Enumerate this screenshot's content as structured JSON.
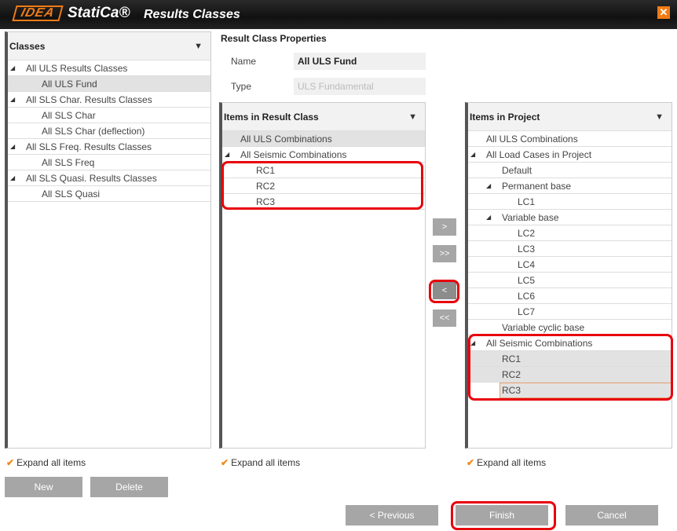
{
  "window": {
    "logo": "IDEA",
    "brand": "StatiCa®",
    "title": "Results Classes",
    "close": "✕"
  },
  "classes": {
    "header": "Classes",
    "rows": [
      {
        "label": "All ULS Results Classes",
        "level": 0,
        "expand": true
      },
      {
        "label": "All ULS Fund",
        "level": 1,
        "selected": true
      },
      {
        "label": "All SLS Char. Results Classes",
        "level": 0,
        "expand": true
      },
      {
        "label": "All SLS Char",
        "level": 1
      },
      {
        "label": "All SLS Char (deflection)",
        "level": 1
      },
      {
        "label": "All SLS Freq. Results Classes",
        "level": 0,
        "expand": true
      },
      {
        "label": "All SLS Freq",
        "level": 1
      },
      {
        "label": "All SLS Quasi. Results Classes",
        "level": 0,
        "expand": true
      },
      {
        "label": "All SLS Quasi",
        "level": 1
      }
    ]
  },
  "properties": {
    "title": "Result Class Properties",
    "name_label": "Name",
    "name_value": "All ULS Fund",
    "type_label": "Type",
    "type_value": "ULS Fundamental"
  },
  "result_items": {
    "header": "Items in Result Class",
    "rows": [
      {
        "label": "All ULS Combinations",
        "level": 0,
        "selected": true
      },
      {
        "label": "All Seismic Combinations",
        "level": 0,
        "expand": true
      },
      {
        "label": "RC1",
        "level": 1
      },
      {
        "label": "RC2",
        "level": 1
      },
      {
        "label": "RC3",
        "level": 1
      }
    ]
  },
  "project_items": {
    "header": "Items in Project",
    "rows": [
      {
        "label": "All ULS Combinations",
        "level": 0
      },
      {
        "label": "All Load Cases in Project",
        "level": 0,
        "expand": true
      },
      {
        "label": "Default",
        "level": 1
      },
      {
        "label": "Permanent base",
        "level": 1,
        "expand": true
      },
      {
        "label": "LC1",
        "level": 2
      },
      {
        "label": "Variable base",
        "level": 1,
        "expand": true
      },
      {
        "label": "LC2",
        "level": 2
      },
      {
        "label": "LC3",
        "level": 2
      },
      {
        "label": "LC4",
        "level": 2
      },
      {
        "label": "LC5",
        "level": 2
      },
      {
        "label": "LC6",
        "level": 2
      },
      {
        "label": "LC7",
        "level": 2
      },
      {
        "label": "Variable cyclic base",
        "level": 1
      },
      {
        "label": "All Seismic Combinations",
        "level": 0,
        "expand": true
      },
      {
        "label": "RC1",
        "level": 1,
        "selected": true
      },
      {
        "label": "RC2",
        "level": 1,
        "selected": true
      },
      {
        "label": "RC3",
        "level": 1,
        "selected": true,
        "focused": true
      }
    ]
  },
  "transfer": {
    "add": ">",
    "add_all": ">>",
    "remove": "<",
    "remove_all": "<<"
  },
  "expand_all": {
    "label": "Expand all items",
    "check": "✔"
  },
  "buttons": {
    "new": "New",
    "delete": "Delete",
    "previous": "< Previous",
    "finish": "Finish",
    "cancel": "Cancel"
  },
  "colors": {
    "accent": "#f07c16",
    "highlight": "#e8000b"
  }
}
